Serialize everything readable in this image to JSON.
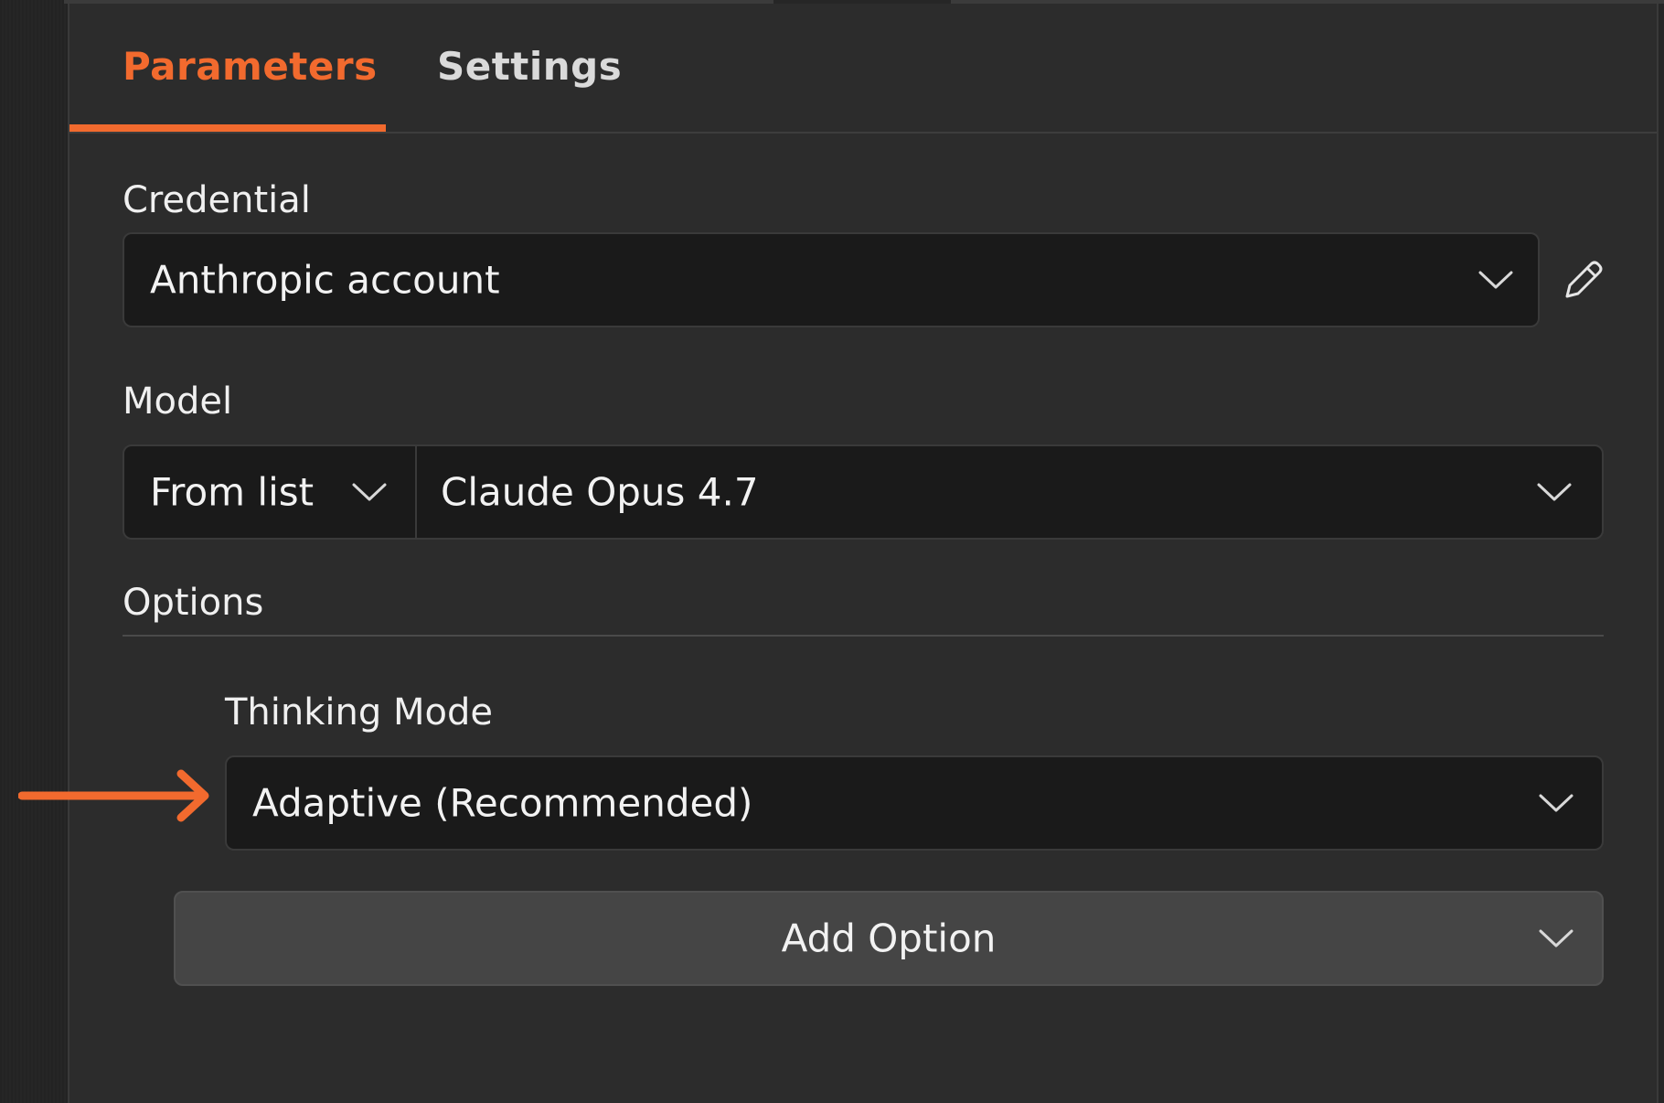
{
  "tabs": {
    "parameters": "Parameters",
    "settings": "Settings"
  },
  "credential": {
    "label": "Credential",
    "value": "Anthropic account"
  },
  "model": {
    "label": "Model",
    "mode": "From list",
    "value": "Claude Opus 4.7"
  },
  "options": {
    "label": "Options",
    "thinking_mode": {
      "label": "Thinking Mode",
      "value": "Adaptive (Recommended)"
    },
    "add_option_label": "Add Option"
  },
  "colors": {
    "accent": "#f26a2e",
    "panel_bg": "#2c2c2c",
    "input_bg": "#1a1a1a"
  }
}
